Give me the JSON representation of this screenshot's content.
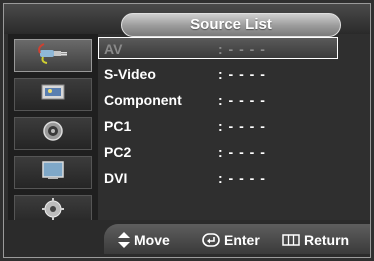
{
  "menu": {
    "title": "Source List"
  },
  "side_icons": [
    {
      "icon": "input-plug-icon",
      "selected": true
    },
    {
      "icon": "picture-icon",
      "selected": false
    },
    {
      "icon": "sound-speaker-icon",
      "selected": false
    },
    {
      "icon": "setup-tv-icon",
      "selected": false
    },
    {
      "icon": "settings-gear-icon",
      "selected": false
    }
  ],
  "sources": [
    {
      "name": "AV",
      "value": ": - - - -",
      "selected": true
    },
    {
      "name": "S-Video",
      "value": ": - - - -",
      "selected": false
    },
    {
      "name": "Component",
      "value": ": - - - -",
      "selected": false
    },
    {
      "name": "PC1",
      "value": ": - - - -",
      "selected": false
    },
    {
      "name": "PC2",
      "value": ": - - - -",
      "selected": false
    },
    {
      "name": "DVI",
      "value": ": - - - -",
      "selected": false
    }
  ],
  "footer": {
    "move_label": "Move",
    "enter_label": "Enter",
    "return_label": "Return"
  }
}
